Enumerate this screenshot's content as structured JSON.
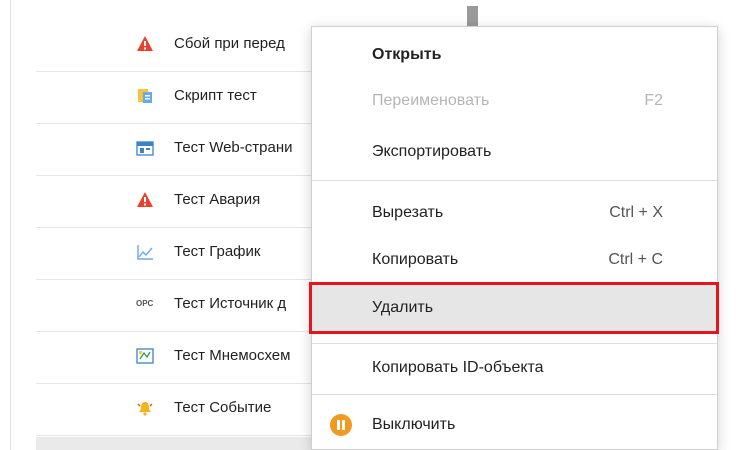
{
  "tree": {
    "items": [
      {
        "label": "Сбой при перед",
        "icon": "alarm-warning-icon"
      },
      {
        "label": "Скрипт тест",
        "icon": "script-icon"
      },
      {
        "label": "Тест Web-страни",
        "icon": "web-page-icon"
      },
      {
        "label": "Тест Авария",
        "icon": "alarm-warning-icon"
      },
      {
        "label": "Тест График",
        "icon": "chart-icon"
      },
      {
        "label": "Тест Источник д",
        "icon": "opc-source-icon",
        "icon_text": "OPC"
      },
      {
        "label": "Тест Мнемосхем",
        "icon": "mnemonic-scheme-icon"
      },
      {
        "label": "Тест Событие",
        "icon": "event-bell-icon"
      }
    ]
  },
  "context_menu": {
    "open": "Открыть",
    "rename": "Переименовать",
    "rename_shortcut": "F2",
    "export": "Экспортировать",
    "cut": "Вырезать",
    "cut_shortcut": "Ctrl + X",
    "copy": "Копировать",
    "copy_shortcut": "Ctrl + C",
    "delete": "Удалить",
    "copy_id": "Копировать ID-объекта",
    "disable": "Выключить"
  },
  "colors": {
    "highlight": "#e8141c",
    "pause": "#f29a1f",
    "warning": "#e8412c"
  }
}
